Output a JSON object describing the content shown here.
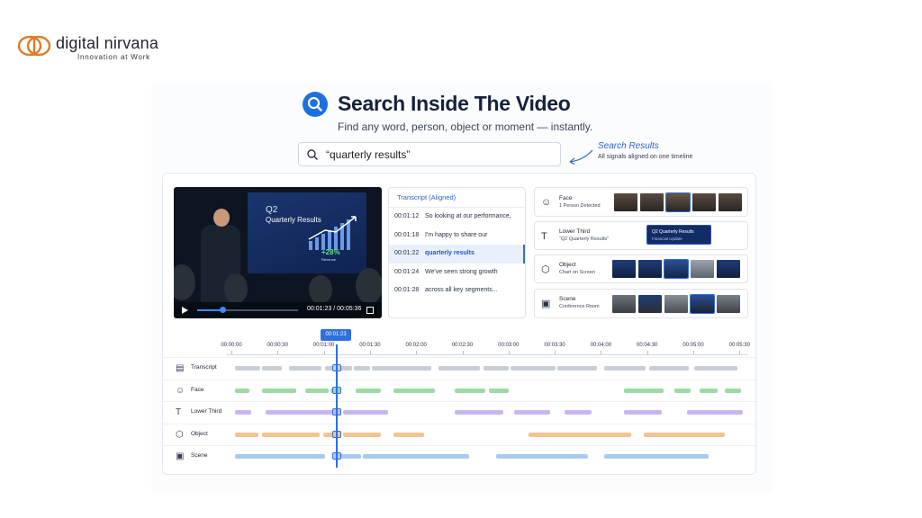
{
  "brand": {
    "name": "digital nirvana",
    "tagline": "Innovation at Work",
    "color": "#e07b2a"
  },
  "hero": {
    "title": "Search Inside The Video",
    "subtitle": "Find any word, person, object or moment — instantly.",
    "accent": "#1e6fe0"
  },
  "search": {
    "value": "“quarterly results”",
    "icon": "search-icon"
  },
  "annotation": {
    "title": "Search Results",
    "subtitle": "All signals aligned on one timeline"
  },
  "video": {
    "slide_q": "Q2",
    "slide_title": "Quarterly Results",
    "slide_pct": "+28%",
    "slide_pct_label": "Revenue",
    "time": "00:01:23 / 00:05:36",
    "progress": 0.25
  },
  "transcript": {
    "header": "Transcript (Aligned)",
    "rows": [
      {
        "time": "00:01:12",
        "text": "So looking at our performance,"
      },
      {
        "time": "00:01:18",
        "text": "I'm happy to share our"
      },
      {
        "time": "00:01:22",
        "text": "quarterly results",
        "active": true
      },
      {
        "time": "00:01:24",
        "text": "We've seen strong growth"
      },
      {
        "time": "00:01:28",
        "text": "across all key segments..."
      }
    ]
  },
  "signals": [
    {
      "title": "Face",
      "subtitle": "1 Person Detected",
      "icon": "face-icon"
    },
    {
      "title": "Lower Third",
      "subtitle": "“Q2 Quarterly Results”",
      "icon": "text-icon",
      "card_title": "Q2 Quarterly Results",
      "card_sub": "Financial Update"
    },
    {
      "title": "Object",
      "subtitle": "Chart on Screen",
      "icon": "cube-icon"
    },
    {
      "title": "Scene",
      "subtitle": "Conference Room",
      "icon": "image-icon"
    }
  ],
  "timeline": {
    "playhead": "00:01:23",
    "ticks": [
      "00:00:00",
      "00:00:30",
      "00:01:00",
      "00:01:30",
      "00:02:00",
      "00:02:30",
      "00:03:00",
      "00:03:30",
      "00:04:00",
      "00:04:30",
      "00:05:00",
      "00:05:30"
    ],
    "tracks": [
      {
        "label": "Transcript",
        "icon": "document-icon",
        "color": "#c9cdd6"
      },
      {
        "label": "Face",
        "icon": "face-icon",
        "color": "#9edaa6"
      },
      {
        "label": "Lower Third",
        "icon": "text-icon",
        "color": "#c8b6ef"
      },
      {
        "label": "Object",
        "icon": "cube-icon",
        "color": "#f4c48f"
      },
      {
        "label": "Scene",
        "icon": "image-icon",
        "color": "#a9cbef"
      }
    ]
  }
}
